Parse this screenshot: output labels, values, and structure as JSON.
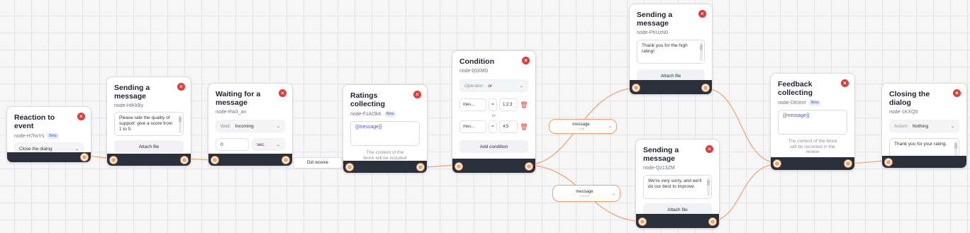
{
  "beta_label": "Beta",
  "nodes": {
    "reaction": {
      "title": "Reaction to event",
      "id": "node-H7hvYs",
      "select_value": "Close the dialog"
    },
    "send1": {
      "title": "Sending a message",
      "id": "node-HtKkBy",
      "message": "Please rate the quality of support: give a score from 1 to 5.",
      "attach_label": "Attach file"
    },
    "wait": {
      "title": "Waiting for a message",
      "id": "node-Rw3_an",
      "wait_label": "Wait:",
      "wait_value": "Incoming",
      "amount": "0",
      "unit": "sec."
    },
    "ratings": {
      "title": "Ratings collecting",
      "id": "node-FzAOkK",
      "variable": "{{message}}",
      "description": "The content of the block will be included in the assessment"
    },
    "condition": {
      "title": "Condition",
      "id": "node-lj5XMD",
      "operator_label": "Operator:",
      "operator_value": "or",
      "rows": [
        {
          "field": "mes...",
          "op": "=",
          "value": "1;2;3"
        },
        {
          "field": "mes...",
          "op": "=",
          "value": "4;5"
        }
      ],
      "or_label": "or",
      "add_label": "Add condition"
    },
    "send_high": {
      "title": "Sending a message",
      "id": "node-PhUzN0",
      "message": "Thank you for the high rating!",
      "attach_label": "Attach file"
    },
    "send_low": {
      "title": "Sending a message",
      "id": "node-Qz13ZM",
      "message": "We're very sorry, and we'll do our best to improve.",
      "attach_label": "Attach file"
    },
    "feedback": {
      "title": "Feedback collecting",
      "id": "node-DKImrr",
      "variable": "{{message}}",
      "description": "The content of the block will be recorded in the review"
    },
    "closing": {
      "title": "Closing the dialog",
      "id": "node-1KXQIt",
      "action_label": "Action:",
      "action_value": "Nothing",
      "message": "Thank you for your rating."
    }
  },
  "edges": {
    "did_receive": "Did receive",
    "cond_high": {
      "label": "message",
      "sub": "= 4;5"
    },
    "cond_low": {
      "label": "message",
      "sub": "= 1;2;3"
    }
  },
  "colors": {
    "edge": "#f0a070",
    "port": "#f4a26a",
    "footer": "#2a2f3c",
    "close": "#e53935"
  }
}
